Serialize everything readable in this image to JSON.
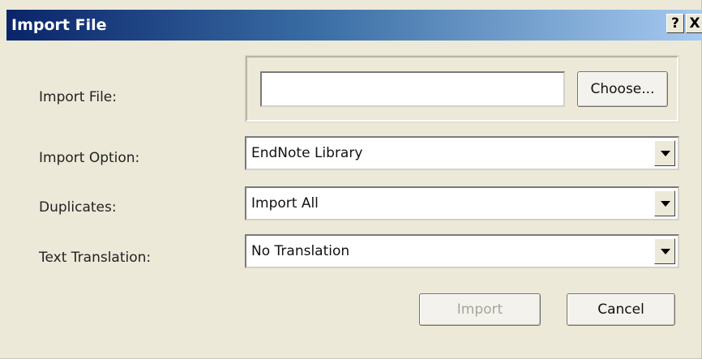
{
  "window": {
    "title": "Import File",
    "help_label": "?",
    "close_label": "X"
  },
  "form": {
    "import_file": {
      "label": "Import File:",
      "value": "",
      "choose_label": "Choose..."
    },
    "import_option": {
      "label": "Import Option:",
      "selected": "EndNote Library"
    },
    "duplicates": {
      "label": "Duplicates:",
      "selected": "Import All"
    },
    "text_translation": {
      "label": "Text Translation:",
      "selected": "No Translation"
    }
  },
  "actions": {
    "import_label": "Import",
    "import_enabled": false,
    "cancel_label": "Cancel"
  },
  "icons": {
    "dropdown_arrow": "chevron-down-icon"
  },
  "colors": {
    "titlebar_start": "#0a246a",
    "titlebar_end": "#a6caf0",
    "dialog_bg": "#ece9d8",
    "disabled_text": "#a8a59a"
  }
}
